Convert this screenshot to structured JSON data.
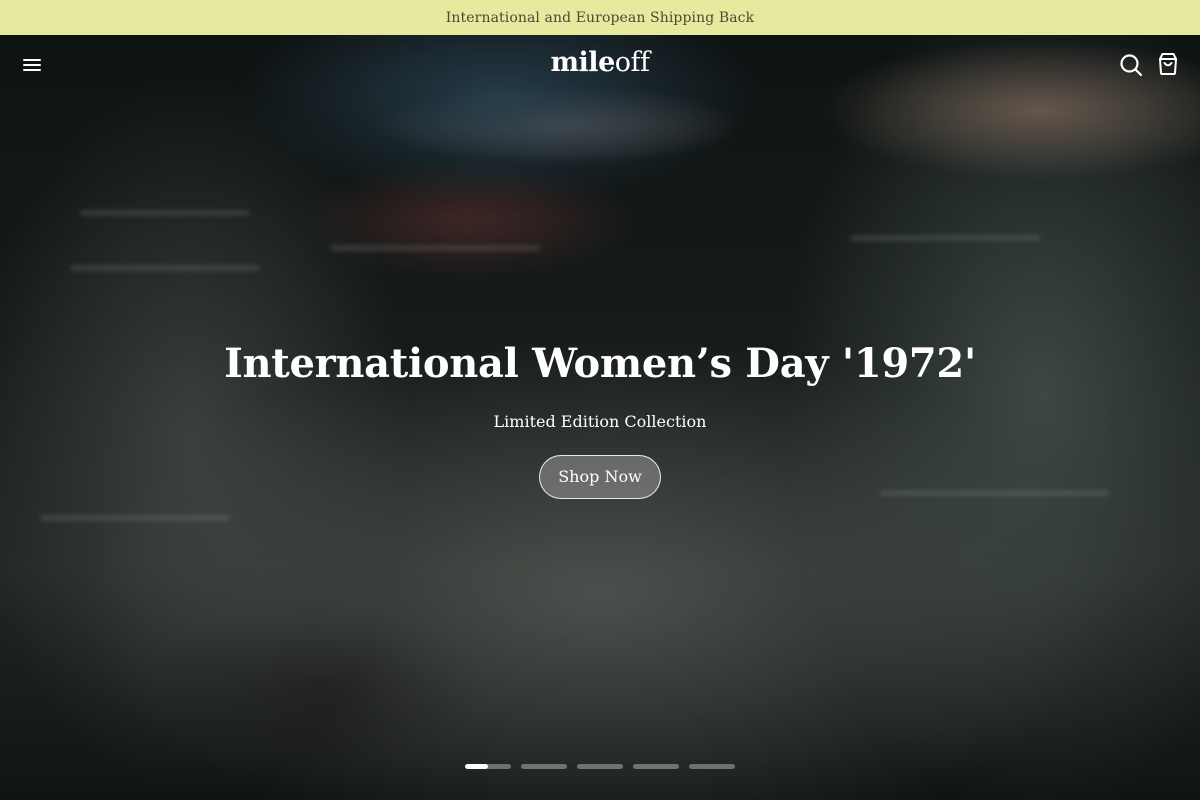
{
  "announcement": {
    "text": "International and European Shipping Back"
  },
  "header": {
    "logo_bold": "mile",
    "logo_light": "off",
    "menu_icon": "hamburger-menu-icon",
    "search_icon": "search-icon",
    "cart_icon": "shopping-bag-icon"
  },
  "hero": {
    "title": "International Women’s Day '1972'",
    "subtitle": "Limited Edition Collection",
    "cta_label": "Shop Now"
  },
  "slider": {
    "total_slides": 5,
    "active_index": 0,
    "active_progress": 0.5
  },
  "colors": {
    "announcement_bg": "#e5ea9f",
    "announcement_text": "#4a4a35",
    "hero_text": "#ffffff"
  }
}
